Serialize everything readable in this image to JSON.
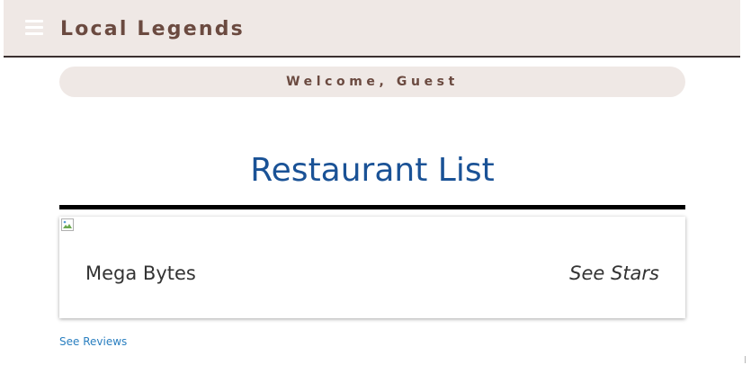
{
  "navbar": {
    "brand": "Local Legends",
    "menu_icon": "hamburger-menu-icon"
  },
  "welcome": {
    "text": "Welcome, Guest"
  },
  "main": {
    "title": "Restaurant List",
    "restaurants": [
      {
        "name": "Mega Bytes",
        "stars_link": "See Stars",
        "reviews_link": "See Reviews",
        "image_icon": "broken-image-icon"
      }
    ]
  },
  "colors": {
    "navbar_bg": "#efe8e5",
    "brand_text": "#6b4a40",
    "title": "#1a5296",
    "link": "#2a7fc0"
  }
}
